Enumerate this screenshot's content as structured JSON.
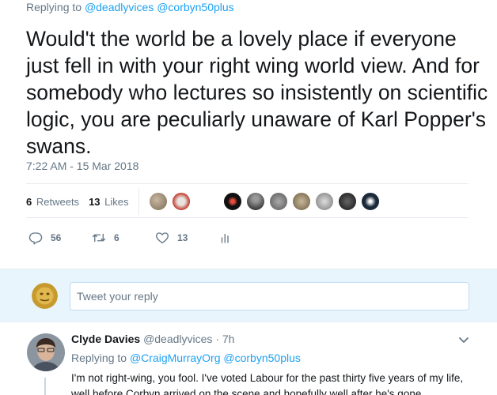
{
  "tweet": {
    "replying_prefix": "Replying to",
    "replying_mentions": "@deadlyvices @corbyn50plus",
    "text": "Would't the world be a lovely place if everyone just fell in with your right wing world view. And for somebody who lectures so insistently on scientific logic, you are peculiarly unaware of Karl Popper's swans.",
    "timestamp": "7:22 AM - 15 Mar 2018"
  },
  "stats": {
    "retweets_count": "6",
    "retweets_label": "Retweets",
    "likes_count": "13",
    "likes_label": "Likes"
  },
  "actions": {
    "reply_count": "56",
    "retweet_count": "6",
    "like_count": "13"
  },
  "reply_box": {
    "placeholder": "Tweet your reply"
  },
  "comment": {
    "name": "Clyde Davies",
    "handle_time": "@deadlyvices · 7h",
    "replying_prefix": "Replying to",
    "replying_mentions": "@CraigMurrayOrg @corbyn50plus",
    "text": "I'm not right-wing, you fool.  I've voted Labour for the past thirty five years of my life, well before Corbyn arrived on the scene and hopefully well after he's gone."
  },
  "colors": {
    "accent": "#1da1f2",
    "muted": "#657786",
    "reply_bg": "#e8f5fd"
  }
}
